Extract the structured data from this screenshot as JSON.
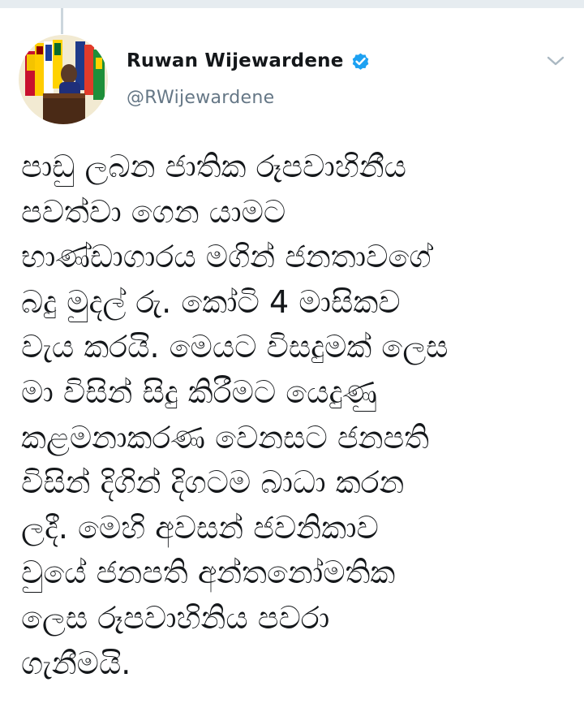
{
  "tweet": {
    "author": {
      "display_name": "Ruwan Wijewardene",
      "handle": "@RWijewardene",
      "verified": true,
      "avatar": "avatar-photo"
    },
    "text_lines": [
      "පාඩු ලබන ජාතික රූපවාහිනීය",
      "පවත්වා ගෙන යාමට",
      "භාණ්ඩාගාරය මගින් ජනතාවගේ",
      "බදු මුදල් රු. කෝටි 4 මාසිකව",
      "වැය කරයි. මෙයට විසදුමක් ලෙස",
      "මා විසින් සිදු කිරීමට යෙදුණු",
      "කළමනාකරණ වෙනසට ජනපති",
      "විසින් දිගින් දිගටම බාධා කරන",
      "ලදී. මෙහි අවසන් ජවනිකාව",
      "වුයේ ජනපති අන්තනෝමතික",
      "ලෙස රූපවාහිනිය පවරා",
      "ගැනීමයි."
    ]
  },
  "icons": {
    "verified": "verified-badge-icon",
    "menu": "chevron-down-icon"
  },
  "colors": {
    "verified_blue": "#1da1f2",
    "handle_gray": "#657786",
    "text": "#14171a",
    "caret_gray": "#aab8c2"
  }
}
